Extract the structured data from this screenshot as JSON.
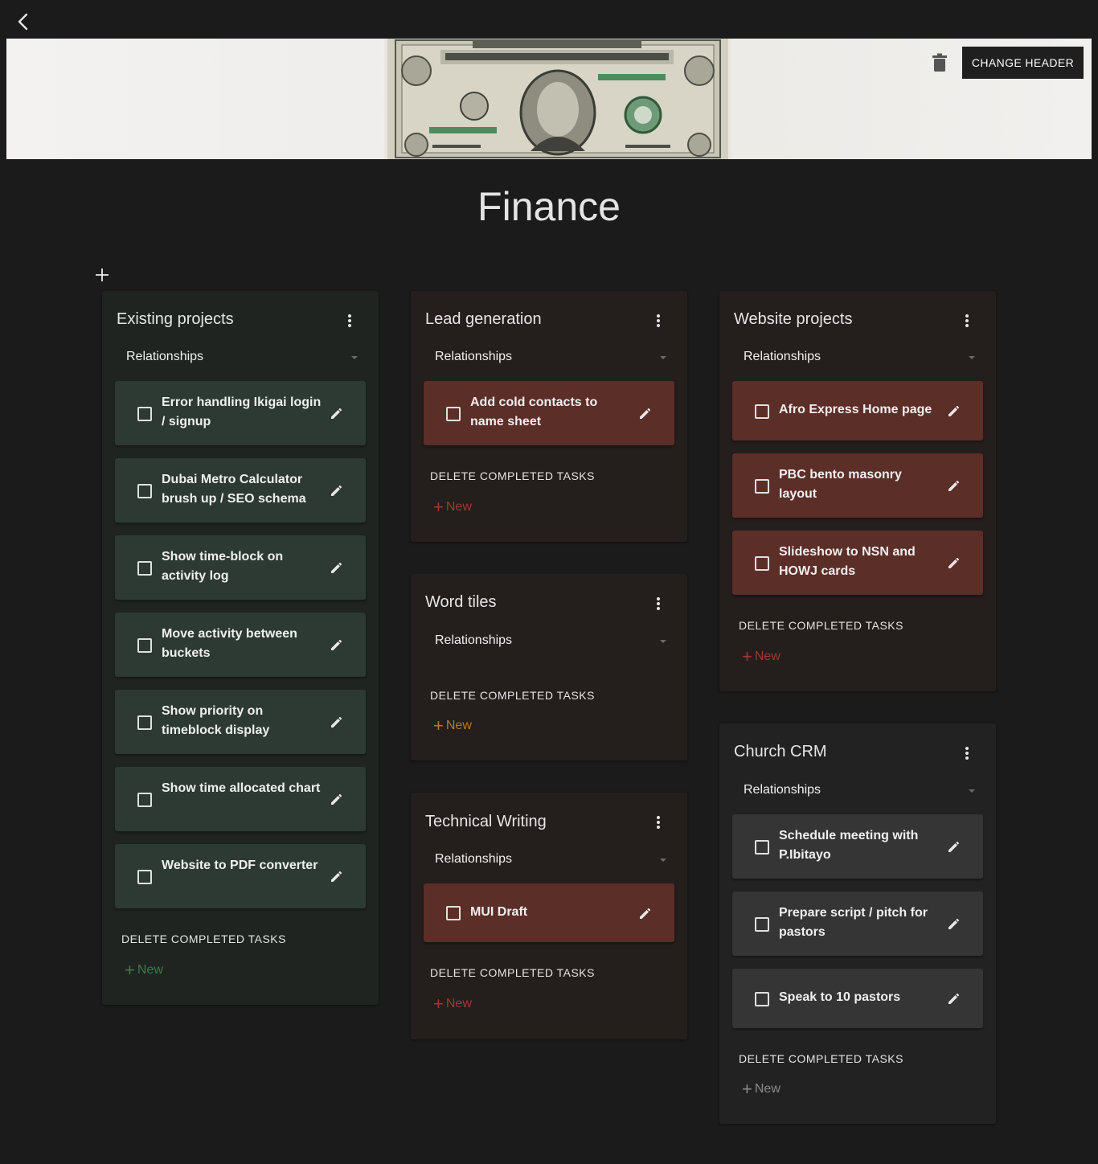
{
  "page": {
    "title": "Finance"
  },
  "header": {
    "change_label": "CHANGE HEADER"
  },
  "boards": [
    {
      "title": "Existing projects",
      "relationship": "Relationships",
      "color": "#2d3a33",
      "tasks": [
        "Error handling Ikigai login / signup",
        "Dubai Metro Calculator brush up / SEO schema",
        "Show time-block on activity log",
        "Move activity between buckets",
        "Show priority on timeblock display",
        "Show time allocated chart",
        "Website to PDF converter"
      ],
      "delete_label": "DELETE COMPLETED TASKS",
      "new_label": "New"
    },
    {
      "title": "Lead generation",
      "relationship": "Relationships",
      "color": "#5c2e28",
      "tasks": [
        "Add cold contacts to name sheet"
      ],
      "delete_label": "DELETE COMPLETED TASKS",
      "new_label": "New"
    },
    {
      "title": "Word tiles",
      "relationship": "Relationships",
      "tasks": [],
      "delete_label": "DELETE COMPLETED TASKS",
      "new_label": "New"
    },
    {
      "title": "Technical Writing",
      "relationship": "Relationships",
      "color": "#5c2e28",
      "tasks": [
        "MUI Draft"
      ],
      "delete_label": "DELETE COMPLETED TASKS",
      "new_label": "New"
    },
    {
      "title": "Website projects",
      "relationship": "Relationships",
      "color": "#5c2e28",
      "tasks": [
        "Afro Express Home page",
        "PBC bento masonry layout",
        "Slideshow to NSN and HOWJ cards"
      ],
      "delete_label": "DELETE COMPLETED TASKS",
      "new_label": "New"
    },
    {
      "title": "Church CRM",
      "relationship": "Relationships",
      "color": "#353535",
      "tasks": [
        "Schedule meeting with P.Ibitayo",
        "Prepare script / pitch for pastors",
        "Speak to 10 pastors"
      ],
      "delete_label": "DELETE COMPLETED TASKS",
      "new_label": "New"
    }
  ]
}
